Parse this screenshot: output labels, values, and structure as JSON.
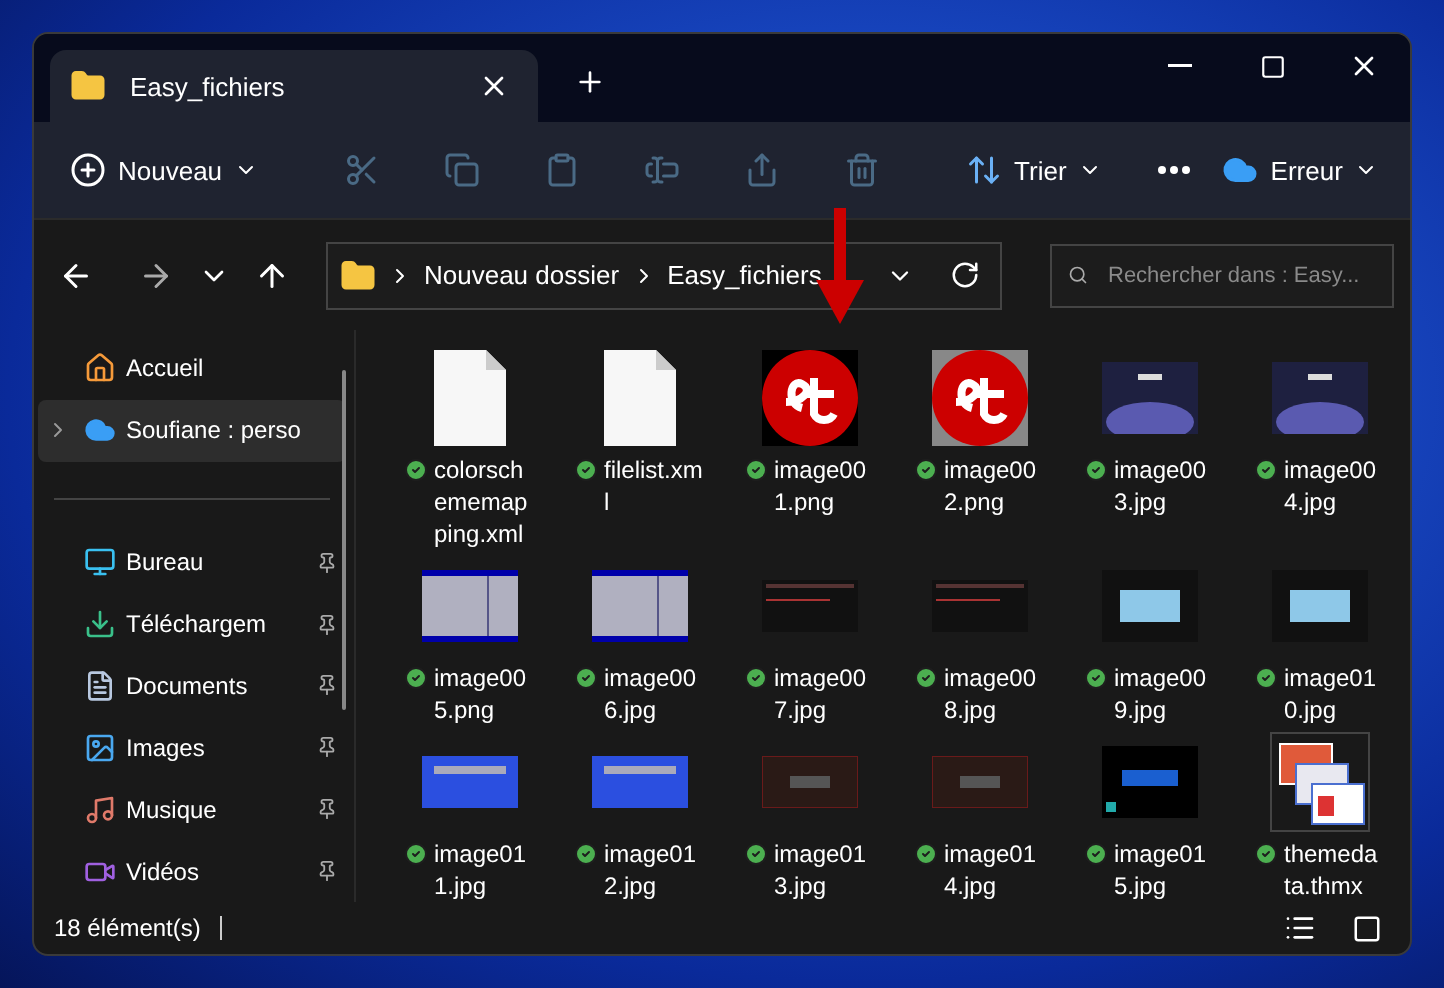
{
  "window": {
    "tab_title": "Easy_fichiers"
  },
  "toolbar": {
    "new_label": "Nouveau",
    "sort_label": "Trier",
    "account_label": "Erreur",
    "actions": [
      {
        "kind": "cut",
        "disabled": true
      },
      {
        "kind": "copy",
        "disabled": true
      },
      {
        "kind": "paste",
        "disabled": true
      },
      {
        "kind": "rename",
        "disabled": true
      },
      {
        "kind": "share",
        "disabled": true
      },
      {
        "kind": "delete",
        "disabled": true
      }
    ]
  },
  "address": {
    "crumbs": [
      "Nouveau dossier",
      "Easy_fichiers"
    ],
    "search_placeholder": "Rechercher dans : Easy..."
  },
  "sidebar": {
    "items": [
      {
        "kind": "home",
        "label": "Accueil",
        "selected": false,
        "pinned": false
      },
      {
        "kind": "cloud",
        "label": "Soufiane : perso",
        "selected": true,
        "pinned": false
      },
      {
        "kind": "divider"
      },
      {
        "kind": "desktop",
        "label": "Bureau",
        "selected": false,
        "pinned": true
      },
      {
        "kind": "download",
        "label": "Téléchargem",
        "selected": false,
        "pinned": true
      },
      {
        "kind": "documents",
        "label": "Documents",
        "selected": false,
        "pinned": true
      },
      {
        "kind": "images",
        "label": "Images",
        "selected": false,
        "pinned": true
      },
      {
        "kind": "music",
        "label": "Musique",
        "selected": false,
        "pinned": true
      },
      {
        "kind": "videos",
        "label": "Vidéos",
        "selected": false,
        "pinned": true
      }
    ]
  },
  "files": [
    {
      "name": "colorschememapping.xml",
      "kind": "blank",
      "synced": true
    },
    {
      "name": "filelist.xml",
      "kind": "blank",
      "synced": true
    },
    {
      "name": "image001.png",
      "kind": "logo-dark",
      "synced": true
    },
    {
      "name": "image002.png",
      "kind": "logo-grey",
      "synced": true
    },
    {
      "name": "image003.jpg",
      "kind": "splash",
      "synced": true
    },
    {
      "name": "image004.jpg",
      "kind": "splash",
      "synced": true
    },
    {
      "name": "image005.png",
      "kind": "bios-grey",
      "synced": true
    },
    {
      "name": "image006.jpg",
      "kind": "bios-grey",
      "synced": true
    },
    {
      "name": "image007.jpg",
      "kind": "bios-dark",
      "synced": true
    },
    {
      "name": "image008.jpg",
      "kind": "bios-dark",
      "synced": true
    },
    {
      "name": "image009.jpg",
      "kind": "dialog",
      "synced": true
    },
    {
      "name": "image010.jpg",
      "kind": "dialog",
      "synced": true
    },
    {
      "name": "image011.jpg",
      "kind": "bluescreen",
      "synced": true
    },
    {
      "name": "image012.jpg",
      "kind": "bluescreen",
      "synced": true
    },
    {
      "name": "image013.jpg",
      "kind": "red-dark",
      "synced": true
    },
    {
      "name": "image014.jpg",
      "kind": "red-dark",
      "synced": true
    },
    {
      "name": "image015.jpg",
      "kind": "brand",
      "synced": true
    },
    {
      "name": "themedata.thmx",
      "kind": "theme",
      "synced": true
    }
  ],
  "status_bar": {
    "count": "18 élément(s)"
  }
}
